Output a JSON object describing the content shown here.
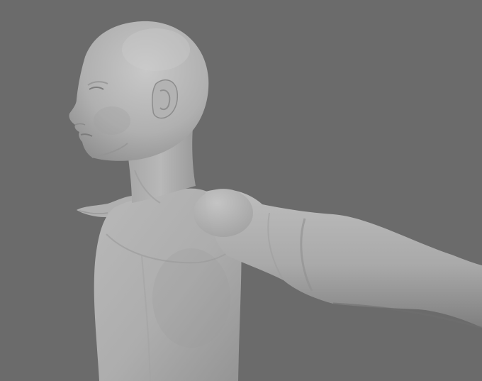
{
  "scene": {
    "background_color": "#6b6b6b",
    "model_base_color": "#b4b4b4",
    "model_shadow_color": "#8a8a8a",
    "model_highlight_color": "#cfcfcf"
  }
}
